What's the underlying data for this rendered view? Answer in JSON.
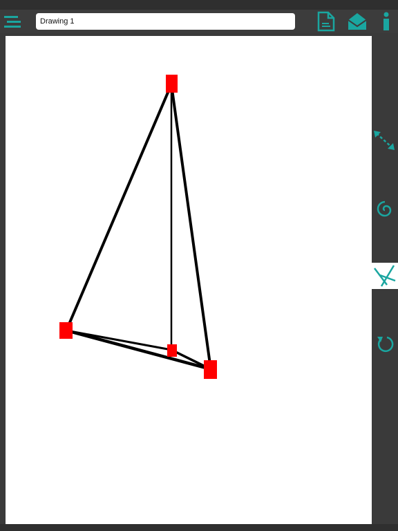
{
  "document": {
    "title": "Drawing 1"
  },
  "colors": {
    "accent": "#1aa6a0",
    "vertex": "#ff0000",
    "edge": "#000000",
    "canvas": "#ffffff",
    "chrome": "#3a3a3a"
  },
  "toolbar": {
    "menu_icon": "hamburger-menu-icon",
    "new_icon": "new-document-icon",
    "mail_icon": "mail-icon",
    "info_icon": "info-icon"
  },
  "sidebar": {
    "tools": [
      {
        "name": "resize-tool",
        "icon": "diagonal-arrows-icon",
        "active": false
      },
      {
        "name": "spiral-tool",
        "icon": "spiral-icon",
        "active": false
      },
      {
        "name": "cut-tool",
        "icon": "cut-lines-icon",
        "active": true
      },
      {
        "name": "reset-tool",
        "icon": "rotate-icon",
        "active": false
      }
    ]
  }
}
